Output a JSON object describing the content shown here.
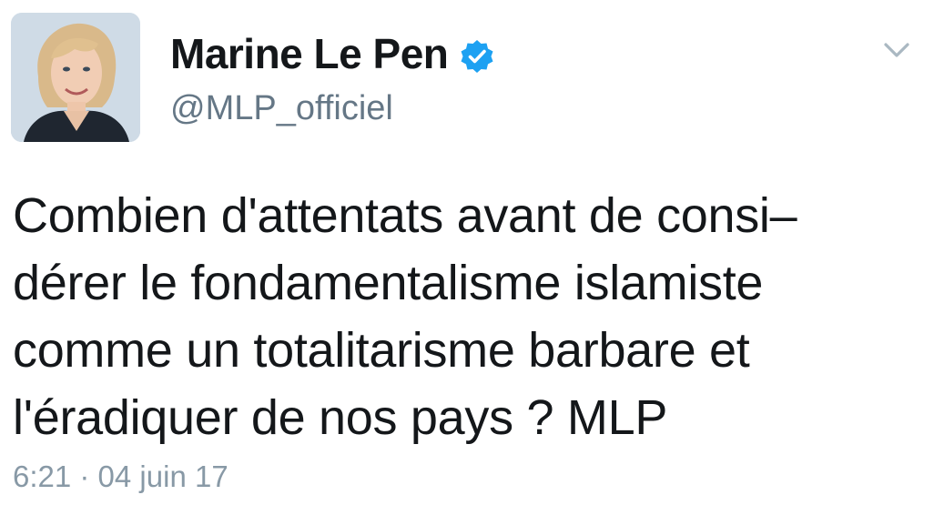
{
  "tweet": {
    "display_name": "Marine Le Pen",
    "handle": "@MLP_officiel",
    "verified_icon": "verified-badge-icon",
    "more_icon": "chevron-down-icon",
    "text_lines": [
      "Combien d'attentats avant de consi–",
      "dérer le fondamentalisme islamiste",
      "comme un totalitarisme barbare et",
      "l'éradiquer de nos pays ? MLP"
    ],
    "timestamp": "6:21 · 04 juin 17"
  },
  "colors": {
    "verified_blue": "#1da1f2",
    "handle_gray": "#657786",
    "timestamp_gray": "#8899a6",
    "caret_gray": "#aab8c2"
  }
}
